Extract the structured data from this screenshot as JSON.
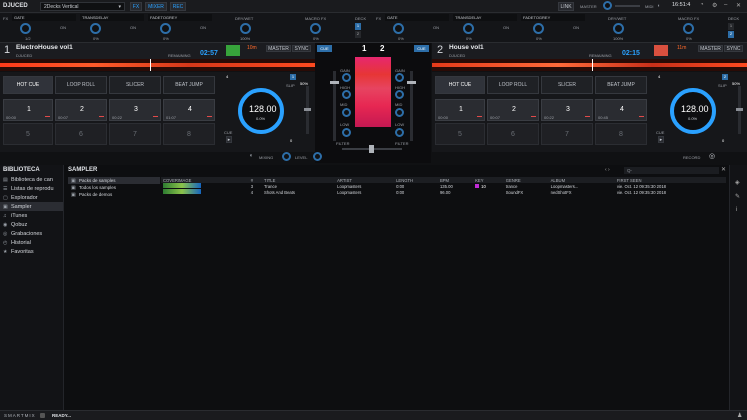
{
  "app": {
    "logo": "DJUCED",
    "layout": "2Decks Vertical",
    "tabs": [
      "FX",
      "MIXER",
      "REC"
    ],
    "link": "LINK",
    "master": "MASTER",
    "midi": "MIDI",
    "clock": "16:51:4"
  },
  "fx": {
    "left": [
      "GATE",
      "TRANSDELAY",
      "FADETOGREY",
      "DRY/WET",
      "MACRO FX"
    ],
    "right": [
      "GATE",
      "TRANSDELAY",
      "FADETOGREY",
      "DRY/WET",
      "MACRO FX"
    ],
    "fx_tag": "FX",
    "deck_tag": "DECK",
    "on": "ON",
    "pct": [
      "1/2",
      "0%",
      "0%",
      "100%",
      "0%"
    ],
    "nums": [
      "1",
      "2"
    ]
  },
  "deck1": {
    "num": "1",
    "title": "ElectroHouse vol1",
    "artist": "DJUCED",
    "remaining": "REMAINING",
    "time": "02:57",
    "minutes": "10m",
    "master": "MASTER",
    "sync": "SYNC",
    "bpm": "128.00",
    "pitch": "0.0%",
    "slip": "SLIP",
    "slip_pct": "50%",
    "loop": "4",
    "cue": "CUE",
    "cue_val": "0",
    "badge": "1"
  },
  "deck2": {
    "num": "2",
    "title": "House vol1",
    "artist": "DJUCED",
    "remaining": "REMAINING",
    "time": "02:15",
    "minutes": "11m",
    "master": "MASTER",
    "sync": "SYNC",
    "bpm": "128.00",
    "pitch": "0.0%",
    "slip": "SLIP",
    "slip_pct": "50%",
    "loop": "4",
    "cue": "CUE",
    "cue_val": "0",
    "badge": "2"
  },
  "pad_modes": [
    "HOT CUE",
    "LOOP ROLL",
    "SLICER",
    "BEAT JUMP"
  ],
  "pads_d1": [
    {
      "n": "1",
      "t": "00:00"
    },
    {
      "n": "2",
      "t": "00:07"
    },
    {
      "n": "3",
      "t": "00:22"
    },
    {
      "n": "4",
      "t": "01:07"
    }
  ],
  "pads_d2": [
    {
      "n": "1",
      "t": "00:00"
    },
    {
      "n": "2",
      "t": "00:07"
    },
    {
      "n": "3",
      "t": "00:22"
    },
    {
      "n": "4",
      "t": "00:45"
    }
  ],
  "pads_grey": [
    "5",
    "6",
    "7",
    "8"
  ],
  "mixer": {
    "cue": "CUE",
    "ch1": "1",
    "ch2": "2",
    "gain": "GAIN",
    "high": "HIGH",
    "mid": "MID",
    "low": "LOW",
    "filter": "FILTER",
    "mixing": "MIXING",
    "level": "LEVEL",
    "record": "RECORD"
  },
  "library": {
    "title": "BIBLIOTECA",
    "items": [
      {
        "icon": "▤",
        "label": "Biblioteca de can",
        "name": "sidebar-item-biblioteca"
      },
      {
        "icon": "☰",
        "label": "Listas de reprodu",
        "name": "sidebar-item-listas"
      },
      {
        "icon": "▢",
        "label": "Explorador",
        "name": "sidebar-item-explorador"
      },
      {
        "icon": "▣",
        "label": "Sampler",
        "name": "sidebar-item-sampler"
      },
      {
        "icon": "♫",
        "label": "iTunes",
        "name": "sidebar-item-itunes"
      },
      {
        "icon": "◉",
        "label": "Qobuz",
        "name": "sidebar-item-qobuz"
      },
      {
        "icon": "◎",
        "label": "Grabaciones",
        "name": "sidebar-item-grabaciones"
      },
      {
        "icon": "◴",
        "label": "Historial",
        "name": "sidebar-item-historial"
      },
      {
        "icon": "★",
        "label": "Favoritas",
        "name": "sidebar-item-favoritas"
      }
    ]
  },
  "sampler": {
    "title": "SAMPLER",
    "folders": [
      "Packs de samples",
      "Todos los samples",
      "Packs de demos"
    ],
    "columns": [
      "COVERIMAGE",
      "#",
      "TITLE",
      "ARTIST",
      "LENGTH",
      "BPM",
      "KEY",
      "GENRE",
      "ALBUM",
      "FIRST SEEN"
    ],
    "rows": [
      {
        "n": "3",
        "title": "Trance",
        "artist": "Loopmasters",
        "length": "0:00",
        "bpm": "135.00",
        "key": "10",
        "genre": "trance",
        "album": "Loopmasters...",
        "seen": "vie. Oct. 12 09:35:30 2018"
      },
      {
        "n": "4",
        "title": "Shots And Beats",
        "artist": "Loopmasters",
        "length": "0:00",
        "bpm": "96.00",
        "key": "",
        "genre": "SoundFX",
        "album": "nedShotFX",
        "seen": "vie. Oct. 12 09:35:30 2018"
      }
    ],
    "search_hint": "Q-"
  },
  "status": {
    "smartmix": "SMARTMIX",
    "ready": "READY..."
  }
}
